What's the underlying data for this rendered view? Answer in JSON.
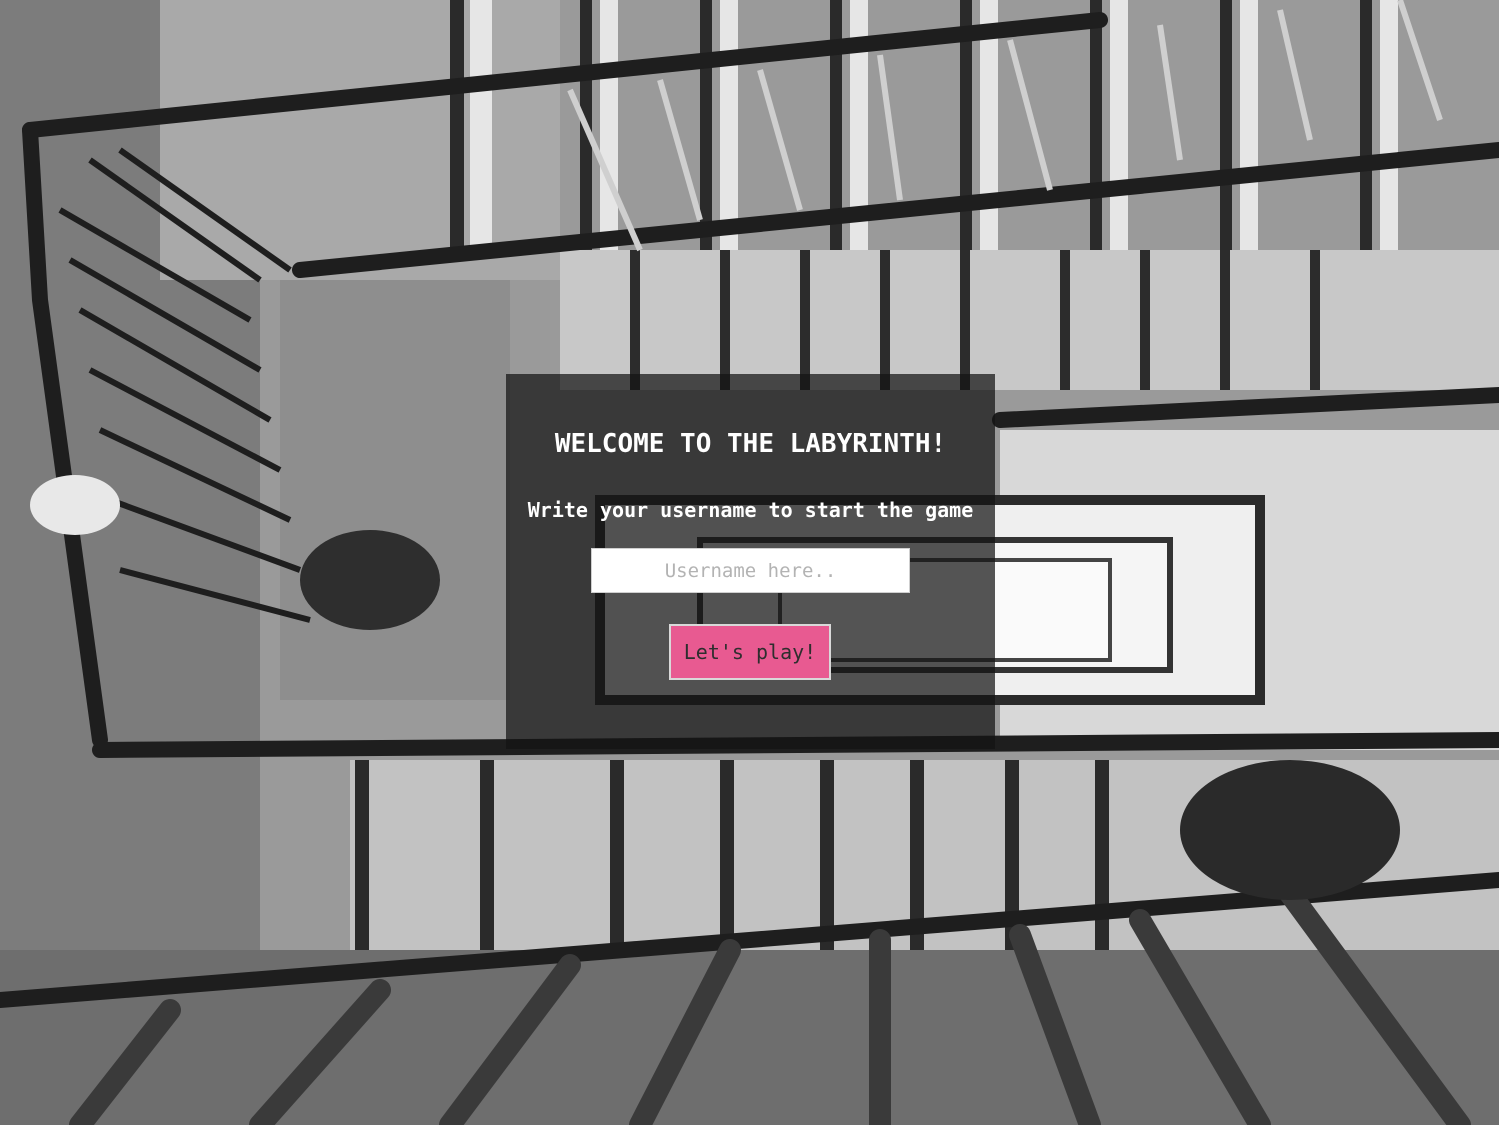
{
  "welcome": {
    "title": "WELCOME TO THE LABYRINTH!",
    "subtitle": "Write your username to start the game",
    "username_placeholder": "Username here..",
    "username_value": "",
    "play_button_label": "Let's play!"
  },
  "colors": {
    "button_accent": "#e85a91",
    "panel_overlay": "#141414",
    "text": "#ffffff"
  },
  "background": {
    "icon": "staircase-photo"
  }
}
